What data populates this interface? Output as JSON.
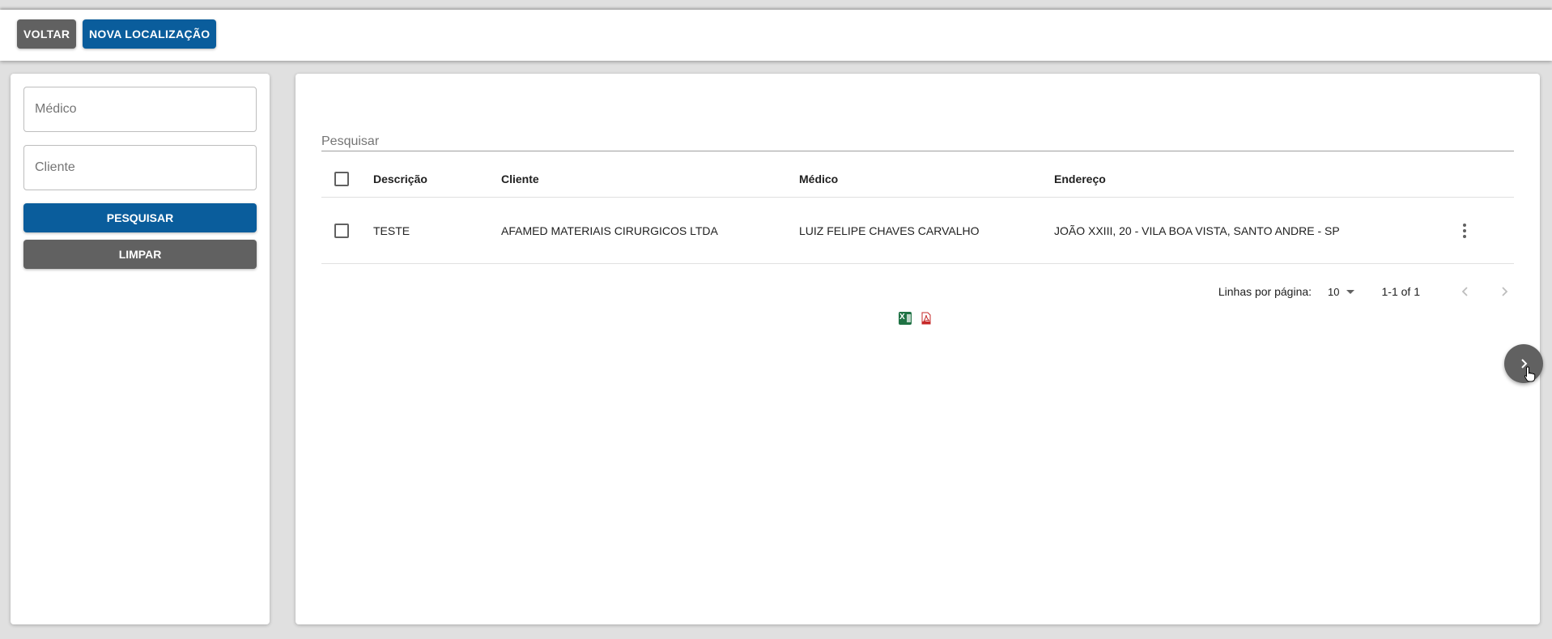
{
  "toolbar": {
    "back_label": "VOLTAR",
    "new_location_label": "NOVA LOCALIZAÇÃO"
  },
  "filters": {
    "medico_placeholder": "Médico",
    "cliente_placeholder": "Cliente",
    "search_label": "PESQUISAR",
    "clear_label": "LIMPAR"
  },
  "search": {
    "placeholder": "Pesquisar"
  },
  "table": {
    "columns": [
      "Descrição",
      "Cliente",
      "Médico",
      "Endereço"
    ],
    "rows": [
      {
        "descricao": "TESTE",
        "cliente": "AFAMED MATERIAIS CIRURGICOS LTDA",
        "medico": "LUIZ FELIPE CHAVES CARVALHO",
        "endereco": "JOÃO XXIII, 20 - VILA BOA VISTA, SANTO ANDRE - SP"
      }
    ]
  },
  "pagination": {
    "rows_per_page_label": "Linhas por página:",
    "rows_per_page_value": "10",
    "range": "1-1 of 1"
  },
  "colors": {
    "primary": "#0a5d9c",
    "secondary": "#616161",
    "background": "#e0e0e0"
  },
  "icons": {
    "export_excel": "excel-icon",
    "export_pdf": "pdf-icon",
    "row_menu": "more-vert-icon",
    "fab": "chevron-right-icon"
  }
}
